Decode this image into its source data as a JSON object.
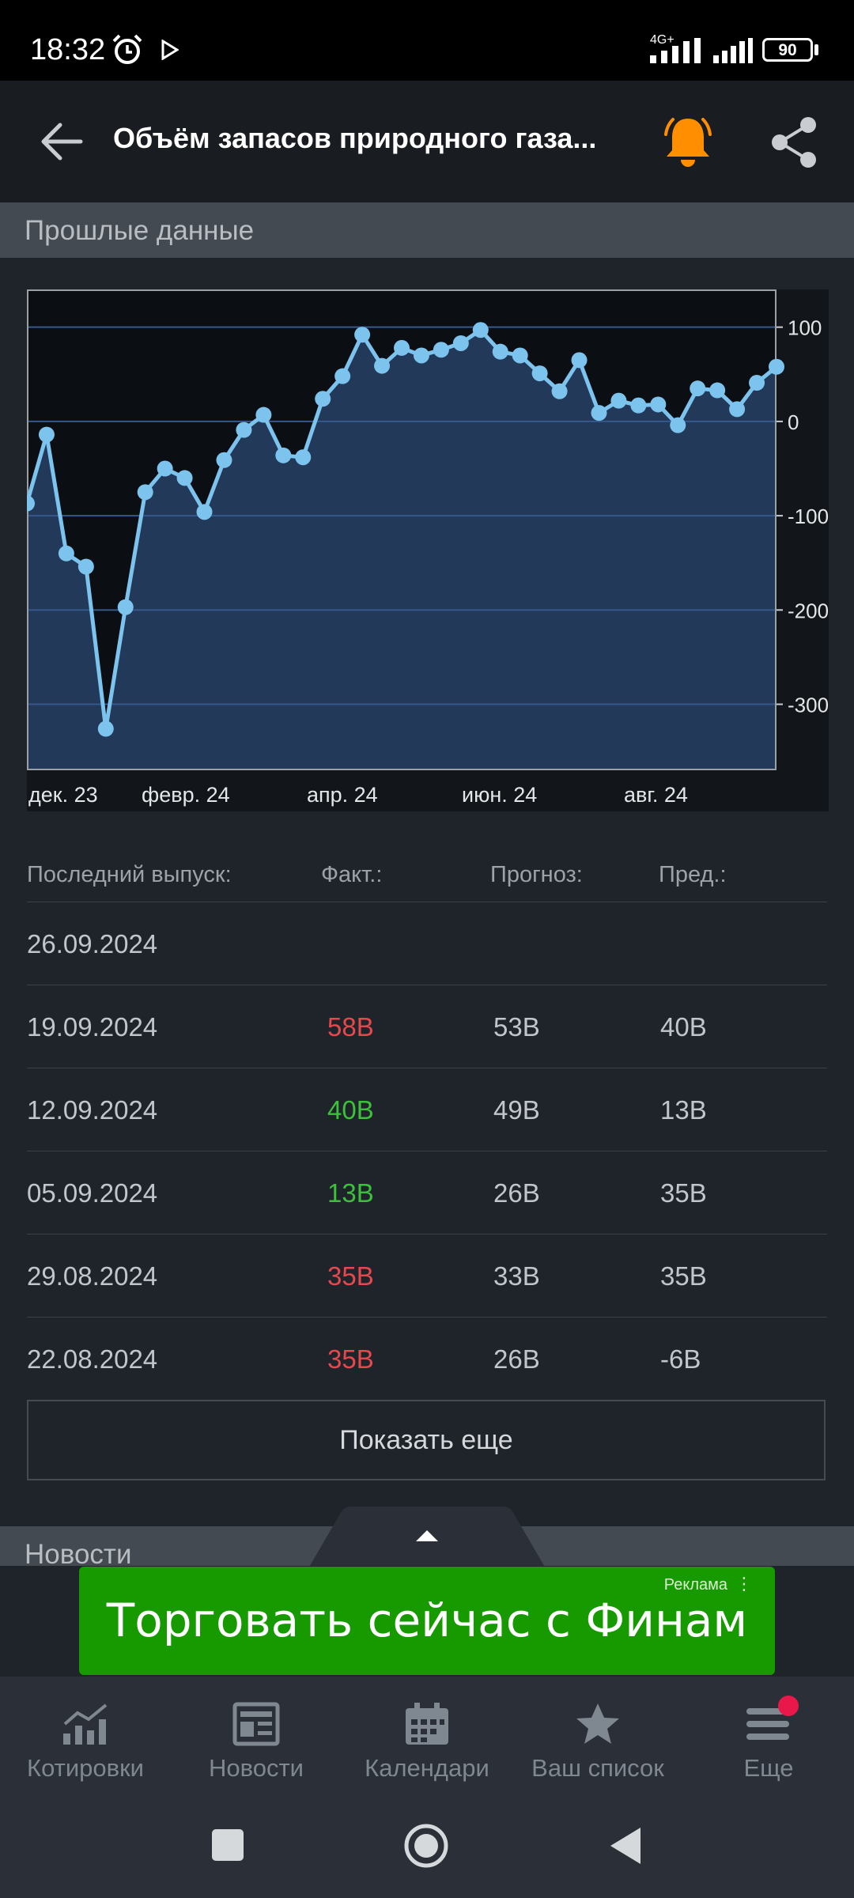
{
  "status": {
    "time": "18:32",
    "network": "4G+",
    "battery": "90"
  },
  "appbar": {
    "title": "Объём запасов природного газа..."
  },
  "history_section": {
    "title": "Прошлые данные"
  },
  "chart_data": {
    "type": "area",
    "x_labels": [
      "дек. 23",
      "февр. 24",
      "апр. 24",
      "июн. 24",
      "авг. 24"
    ],
    "y_ticks": [
      100,
      0,
      -100,
      -200,
      -300
    ],
    "ylim": [
      -370,
      140
    ],
    "values": [
      -87,
      -14,
      -140,
      -154,
      -326,
      -197,
      -75,
      -50,
      -60,
      -96,
      -41,
      -9,
      7,
      -36,
      -38,
      24,
      48,
      92,
      59,
      78,
      70,
      76,
      83,
      97,
      74,
      70,
      51,
      32,
      65,
      9,
      22,
      17,
      18,
      -4,
      35,
      33,
      13,
      41,
      58
    ],
    "grid": true
  },
  "table": {
    "headers": [
      "Последний выпуск:",
      "Факт.:",
      "Прогноз:",
      "Пред.:"
    ],
    "rows": [
      {
        "date": "26.09.2024",
        "actual": "",
        "forecast": "",
        "previous": "",
        "color": "#c2c6cb"
      },
      {
        "date": "19.09.2024",
        "actual": "58B",
        "forecast": "53B",
        "previous": "40B",
        "color": "#e5484d"
      },
      {
        "date": "12.09.2024",
        "actual": "40B",
        "forecast": "49B",
        "previous": "13B",
        "color": "#3cc13b"
      },
      {
        "date": "05.09.2024",
        "actual": "13B",
        "forecast": "26B",
        "previous": "35B",
        "color": "#3cc13b"
      },
      {
        "date": "29.08.2024",
        "actual": "35B",
        "forecast": "33B",
        "previous": "35B",
        "color": "#e5484d"
      },
      {
        "date": "22.08.2024",
        "actual": "35B",
        "forecast": "26B",
        "previous": "-6B",
        "color": "#e5484d"
      }
    ],
    "show_more": "Показать еще"
  },
  "news_section": {
    "title": "Новости"
  },
  "ad": {
    "text": "Торговать сейчас с Финам",
    "label": "Реклама"
  },
  "bottom_nav": [
    {
      "label": "Котировки",
      "icon": "chart-icon"
    },
    {
      "label": "Новости",
      "icon": "news-icon"
    },
    {
      "label": "Календари",
      "icon": "calendar-icon"
    },
    {
      "label": "Ваш список",
      "icon": "star-icon"
    },
    {
      "label": "Еще",
      "icon": "menu-icon"
    }
  ],
  "colors": {
    "accent": "#ff8f00",
    "line": "#7cc3ee",
    "positive": "#3cc13b",
    "negative": "#e5484d"
  }
}
